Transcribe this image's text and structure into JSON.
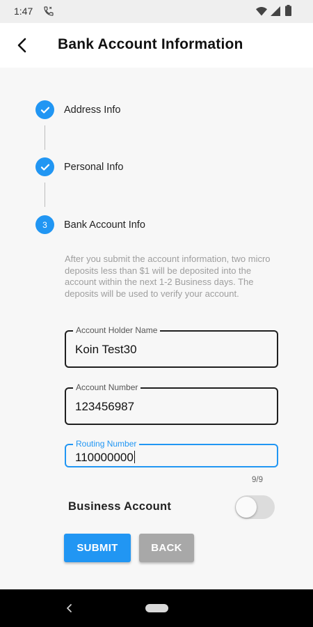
{
  "status_bar": {
    "time": "1:47",
    "icons": [
      "call-icon",
      "wifi-icon",
      "signal-icon",
      "battery-icon"
    ]
  },
  "header": {
    "title": "Bank Account Information",
    "back_icon": "arrow-back-icon"
  },
  "steps": [
    {
      "label": "Address Info",
      "status": "complete",
      "marker": "check-icon"
    },
    {
      "label": "Personal Info",
      "status": "complete",
      "marker": "check-icon"
    },
    {
      "label": "Bank Account Info",
      "status": "active",
      "number": "3"
    }
  ],
  "info_text": "After you submit the account information, two micro deposits less than $1 will be deposited into the account within the next 1-2 Business days. The deposits will be used to verify your account.",
  "form": {
    "account_holder": {
      "label": "Account Holder Name",
      "value": "Koin Test30"
    },
    "account_number": {
      "label": "Account Number",
      "value": "123456987"
    },
    "routing_number": {
      "label": "Routing Number",
      "value": "110000000",
      "counter": "9/9",
      "focused": true
    }
  },
  "business_account": {
    "label": "Business Account",
    "enabled": false
  },
  "buttons": {
    "submit": "SUBMIT",
    "back": "BACK"
  },
  "colors": {
    "accent": "#2196f3",
    "back_button": "#a8a8a8",
    "toggle_off": "#dcdcdc"
  },
  "nav_bar": {
    "icons": [
      "nav-back-icon",
      "home-pill-icon"
    ]
  }
}
